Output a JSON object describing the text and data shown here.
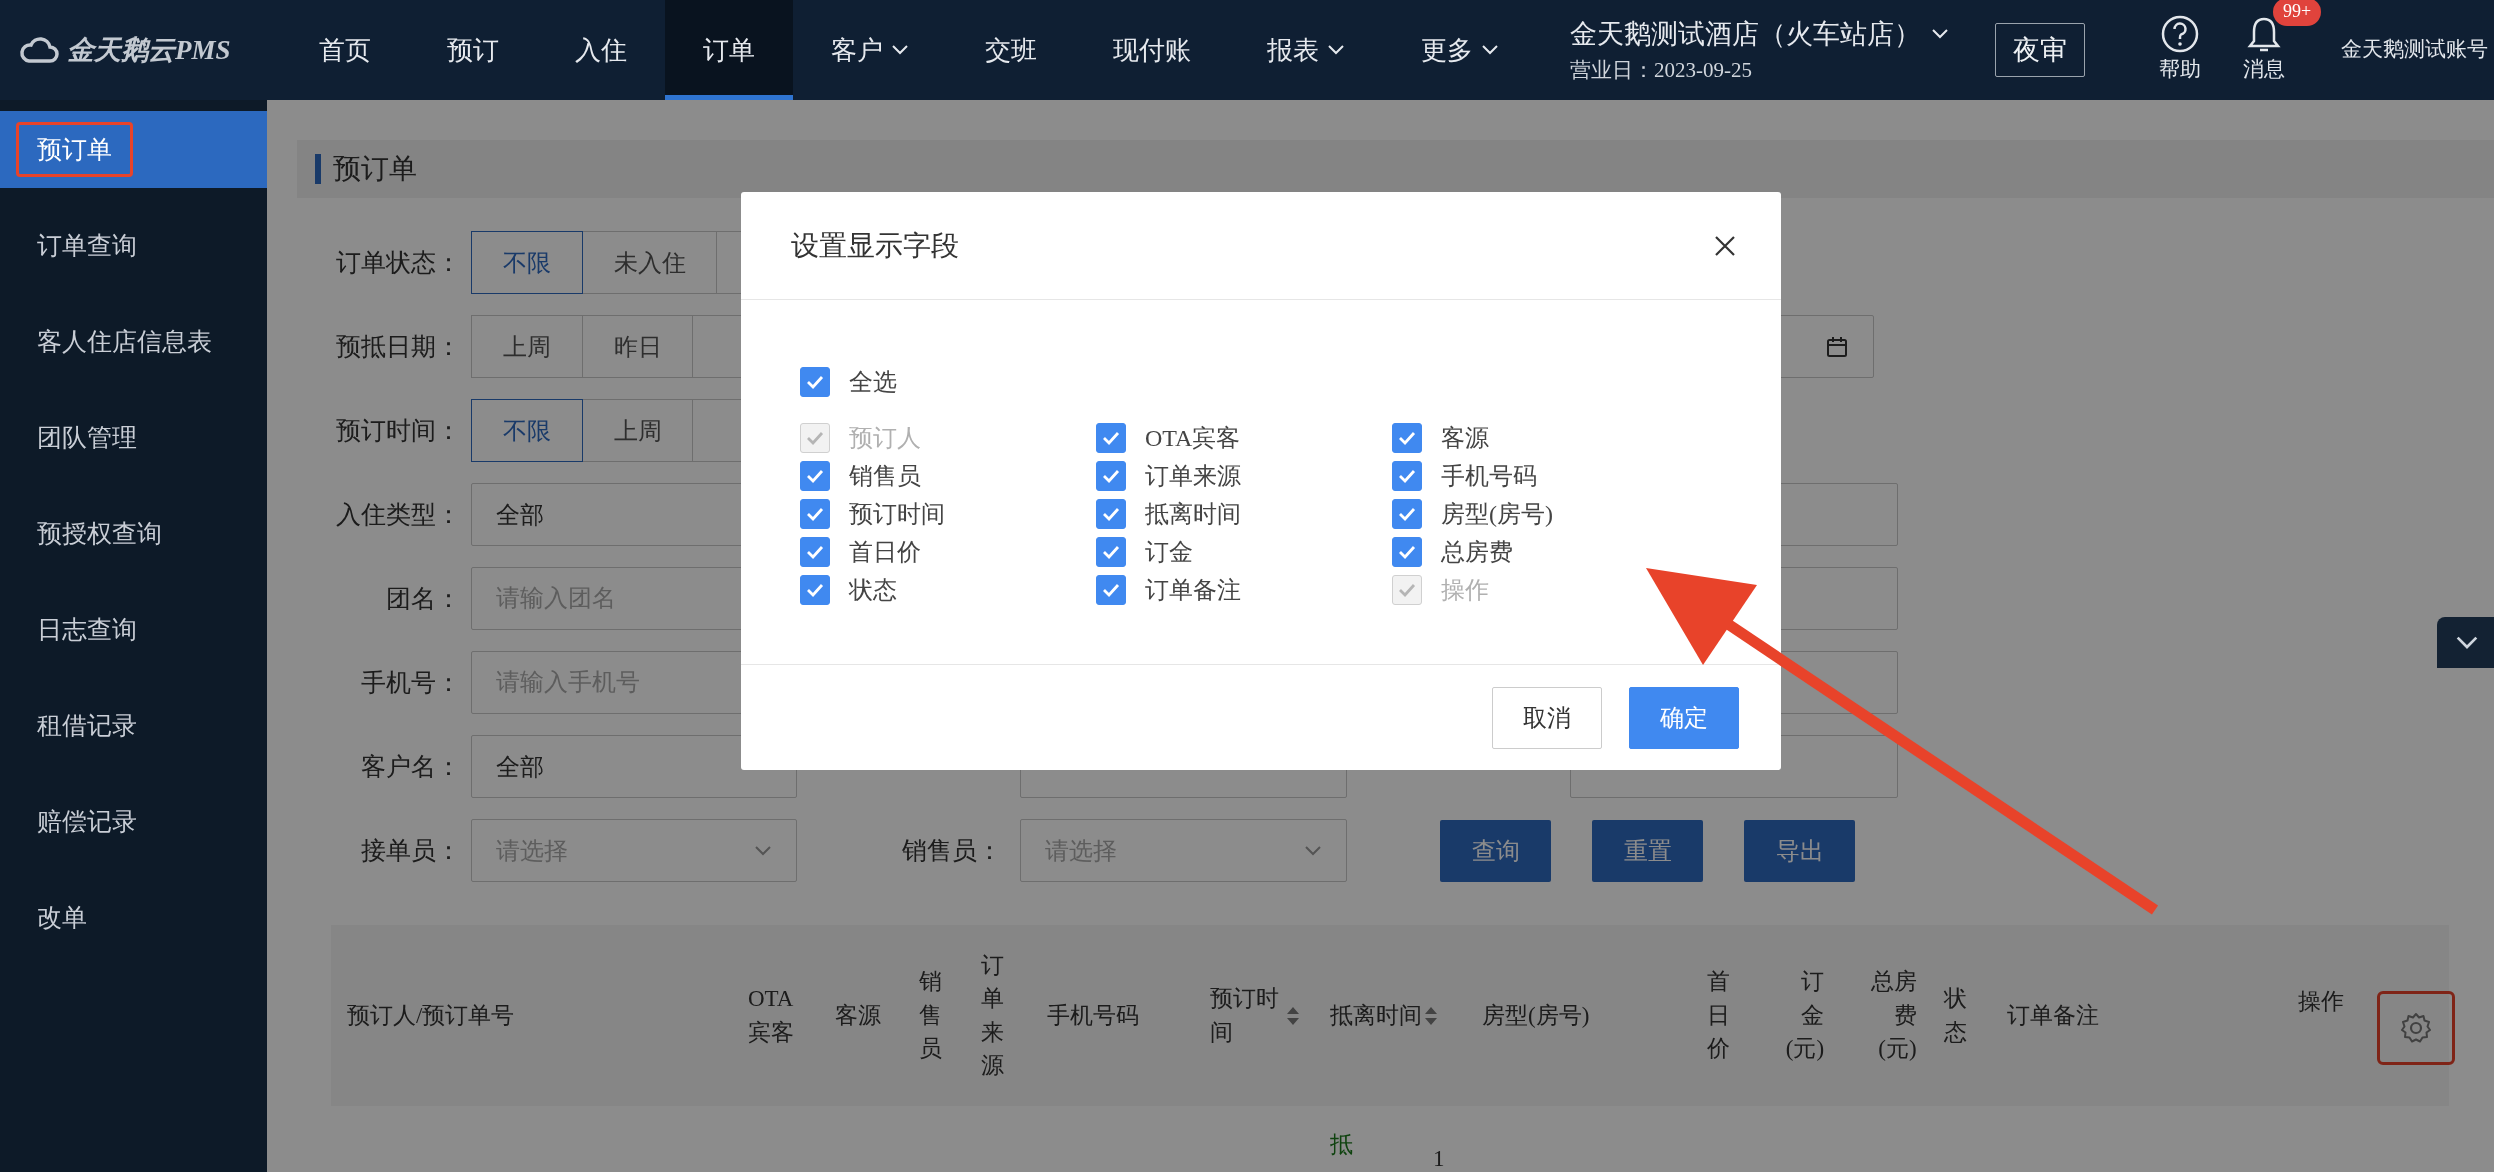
{
  "nav": {
    "logo": "金天鹅云PMS",
    "items": [
      {
        "label": "首页",
        "selected": false,
        "dropdown": false
      },
      {
        "label": "预订",
        "selected": false,
        "dropdown": false
      },
      {
        "label": "入住",
        "selected": false,
        "dropdown": false
      },
      {
        "label": "订单",
        "selected": true,
        "dropdown": false
      },
      {
        "label": "客户",
        "selected": false,
        "dropdown": true
      },
      {
        "label": "交班",
        "selected": false,
        "dropdown": false
      },
      {
        "label": "现付账",
        "selected": false,
        "dropdown": false
      },
      {
        "label": "报表",
        "selected": false,
        "dropdown": true
      },
      {
        "label": "更多",
        "selected": false,
        "dropdown": true
      }
    ],
    "hotel": "金天鹅测试酒店（火车站店）",
    "business_day": "营业日：2023-09-25",
    "night_audit": "夜审",
    "help": "帮助",
    "messages": "消息",
    "badge": "99+",
    "account": "金天鹅测试账号"
  },
  "sidebar": {
    "items": [
      {
        "label": "预订单",
        "selected": true,
        "highlighted": true
      },
      {
        "label": "订单查询",
        "selected": false,
        "highlighted": false
      },
      {
        "label": "客人住店信息表",
        "selected": false,
        "highlighted": false
      },
      {
        "label": "团队管理",
        "selected": false,
        "highlighted": false
      },
      {
        "label": "预授权查询",
        "selected": false,
        "highlighted": false
      },
      {
        "label": "日志查询",
        "selected": false,
        "highlighted": false
      },
      {
        "label": "租借记录",
        "selected": false,
        "highlighted": false
      },
      {
        "label": "赔偿记录",
        "selected": false,
        "highlighted": false
      },
      {
        "label": "改单",
        "selected": false,
        "highlighted": false
      }
    ]
  },
  "page_title": "预订单",
  "filters": [
    {
      "label": "订单状态：",
      "kind": "segmented",
      "options": [
        {
          "label": "不限",
          "selected": true
        },
        {
          "label": "未入住",
          "selected": false
        }
      ]
    },
    {
      "label": "预抵日期：",
      "kind": "segmented",
      "options": [
        {
          "label": "上周",
          "selected": false
        },
        {
          "label": "昨日",
          "selected": false
        }
      ]
    },
    {
      "label": "预订时间：",
      "kind": "segmented",
      "options": [
        {
          "label": "不限",
          "selected": true
        },
        {
          "label": "上周",
          "selected": false
        }
      ]
    },
    {
      "label": "入住类型：",
      "kind": "select",
      "value": "全部"
    },
    {
      "label": "团名：",
      "kind": "input",
      "placeholder": "请输入团名"
    },
    {
      "label": "手机号：",
      "kind": "input",
      "placeholder": "请输入手机号"
    },
    {
      "label": "客户名：",
      "kind": "select",
      "value": "全部"
    },
    {
      "label": "接单员：",
      "kind": "select",
      "placeholder": "请选择"
    }
  ],
  "salesperson": {
    "label": "销售员：",
    "placeholder": "请选择"
  },
  "actions": [
    "查询",
    "重置",
    "导出"
  ],
  "table": {
    "columns": [
      {
        "label": "预订人/预订单号",
        "sortable": false
      },
      {
        "label": "OTA宾客",
        "sortable": false
      },
      {
        "label": "客源",
        "sortable": false
      },
      {
        "label": "销售员",
        "sortable": false
      },
      {
        "label": "订单来源",
        "sortable": false
      },
      {
        "label": "手机号码",
        "sortable": false
      },
      {
        "label": "预订时间",
        "sortable": true
      },
      {
        "label": "抵离时间",
        "sortable": true
      },
      {
        "label": "房型(房号)",
        "sortable": false
      },
      {
        "label": "首日价",
        "sortable": false
      },
      {
        "label": "订金(元)",
        "sortable": false
      },
      {
        "label": "总房费(元)",
        "sortable": false
      },
      {
        "label": "状态",
        "sortable": false
      },
      {
        "label": "订单备注",
        "sortable": false
      },
      {
        "label": "操作",
        "sortable": false
      }
    ],
    "settings_highlighted": true,
    "rows": [
      {
        "texts": [
          "抵",
          "1"
        ]
      }
    ]
  },
  "modal": {
    "title": "设置显示字段",
    "select_all": {
      "label": "全选",
      "checked": true
    },
    "fields": [
      {
        "label": "预订人",
        "checked": true,
        "disabled": true
      },
      {
        "label": "OTA宾客",
        "checked": true,
        "disabled": false
      },
      {
        "label": "客源",
        "checked": true,
        "disabled": false
      },
      {
        "label": "销售员",
        "checked": true,
        "disabled": false
      },
      {
        "label": "订单来源",
        "checked": true,
        "disabled": false
      },
      {
        "label": "手机号码",
        "checked": true,
        "disabled": false
      },
      {
        "label": "预订时间",
        "checked": true,
        "disabled": false
      },
      {
        "label": "抵离时间",
        "checked": true,
        "disabled": false
      },
      {
        "label": "房型(房号)",
        "checked": true,
        "disabled": false
      },
      {
        "label": "首日价",
        "checked": true,
        "disabled": false
      },
      {
        "label": "订金",
        "checked": true,
        "disabled": false
      },
      {
        "label": "总房费",
        "checked": true,
        "disabled": false
      },
      {
        "label": "状态",
        "checked": true,
        "disabled": false
      },
      {
        "label": "订单备注",
        "checked": true,
        "disabled": false
      },
      {
        "label": "操作",
        "checked": true,
        "disabled": true
      }
    ],
    "buttons": [
      {
        "label": "取消",
        "kind": "secondary"
      },
      {
        "label": "确定",
        "kind": "primary"
      }
    ]
  }
}
